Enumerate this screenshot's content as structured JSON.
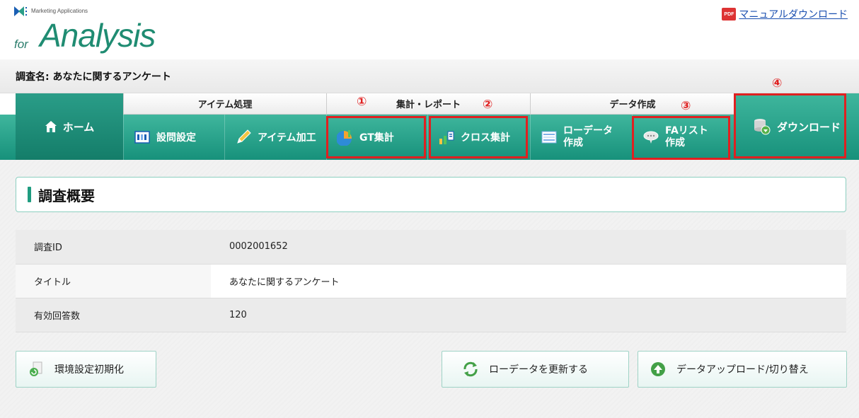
{
  "header": {
    "logo_small": "Marketing Applications",
    "logo_for": "for",
    "logo_big": "Analysis",
    "pdf_badge": "PDF",
    "manual_link": "マニュアルダウンロード"
  },
  "survey": {
    "name_label": "調査名: あなたに関するアンケート"
  },
  "nav": {
    "home": "ホーム",
    "groups": [
      "アイテム処理",
      "集計・レポート",
      "データ作成"
    ],
    "items": [
      {
        "label": "設問設定",
        "icon": "settings-icon"
      },
      {
        "label": "アイテム加工",
        "icon": "pencil-icon"
      },
      {
        "label": "GT集計",
        "icon": "gt-chart-icon"
      },
      {
        "label": "クロス集計",
        "icon": "cross-chart-icon"
      },
      {
        "label_line1": "ローデータ",
        "label_line2": "作成",
        "icon": "raw-data-icon"
      },
      {
        "label_line1": "FAリスト",
        "label_line2": "作成",
        "icon": "fa-list-icon"
      }
    ],
    "download": "ダウンロード",
    "markers": [
      "①",
      "②",
      "③",
      "④"
    ],
    "highlight_color": "#e02020"
  },
  "overview": {
    "title": "調査概要",
    "rows": [
      {
        "key": "調査ID",
        "value": "0002001652"
      },
      {
        "key": "タイトル",
        "value": "あなたに関するアンケート"
      },
      {
        "key": "有効回答数",
        "value": "120"
      }
    ]
  },
  "buttons": {
    "reset": "環境設定初期化",
    "refresh": "ローデータを更新する",
    "upload": "データアップロード/切り替え"
  },
  "colors": {
    "accent": "#1f9c80",
    "nav_green": "#17917b"
  }
}
